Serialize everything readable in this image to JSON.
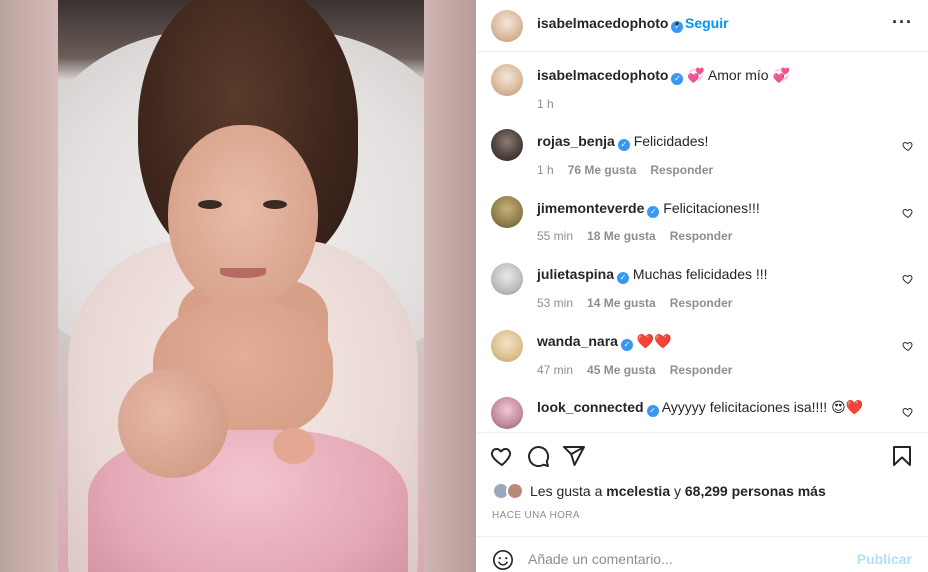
{
  "post": {
    "author": "isabelmacedophoto",
    "follow_label": "Seguir",
    "dot": "•",
    "more": "···"
  },
  "caption": {
    "user": "isabelmacedophoto",
    "text": "💞 Amor mío 💞",
    "time": "1 h"
  },
  "comments": [
    {
      "user": "rojas_benja",
      "text": "Felicidades!",
      "time": "1 h",
      "likes": "76 Me gusta",
      "reply": "Responder"
    },
    {
      "user": "jimemonteverde",
      "text": "Felicitaciones!!!",
      "time": "55 min",
      "likes": "18 Me gusta",
      "reply": "Responder"
    },
    {
      "user": "julietaspina",
      "text": "Muchas felicidades !!!",
      "time": "53 min",
      "likes": "14 Me gusta",
      "reply": "Responder"
    },
    {
      "user": "wanda_nara",
      "text": "❤️❤️",
      "time": "47 min",
      "likes": "45 Me gusta",
      "reply": "Responder"
    },
    {
      "user": "look_connected",
      "text": "Ayyyyy felicitaciones isa!!!! 😍❤️"
    }
  ],
  "likes": {
    "prefix": "Les gusta a",
    "user": "mcelestia",
    "middle": "y",
    "count": "68,299 personas más"
  },
  "time_ago": "HACE UNA HORA",
  "add_comment": {
    "placeholder": "Añade un comentario...",
    "publish": "Publicar"
  },
  "icons": [
    "heart-icon",
    "comment-icon",
    "share-icon",
    "bookmark-icon",
    "emoji-icon",
    "verified-icon"
  ],
  "colors": {
    "accent": "#0095f6",
    "publish_disabled": "#b2dffc",
    "verified": "#3897f0",
    "muted": "#8e8e8e"
  }
}
